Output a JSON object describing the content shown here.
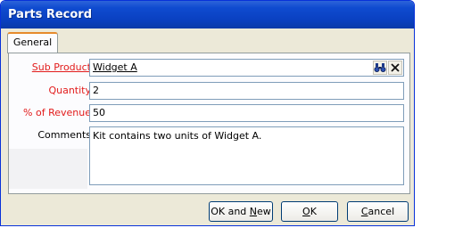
{
  "window": {
    "title": "Parts Record"
  },
  "tabs": [
    {
      "label": "General"
    }
  ],
  "form": {
    "sub_product": {
      "label": "Sub Product",
      "value": "Widget A"
    },
    "quantity": {
      "label": "Quantity",
      "value": "2"
    },
    "percent_revenue": {
      "label": "% of Revenue",
      "value": "50"
    },
    "comments": {
      "label": "Comments",
      "value": "Kit contains two units of Widget A."
    }
  },
  "buttons": {
    "ok_and_new": {
      "pre": "OK and ",
      "key": "N",
      "post": "ew"
    },
    "ok": {
      "pre": "",
      "key": "O",
      "post": "K"
    },
    "cancel": {
      "pre": "",
      "key": "C",
      "post": "ancel"
    }
  },
  "icons": {
    "find": "binoculars-icon",
    "clear": "close-icon"
  },
  "colors": {
    "required_label": "#e21b1b",
    "title_bar": "#0a40c0"
  }
}
